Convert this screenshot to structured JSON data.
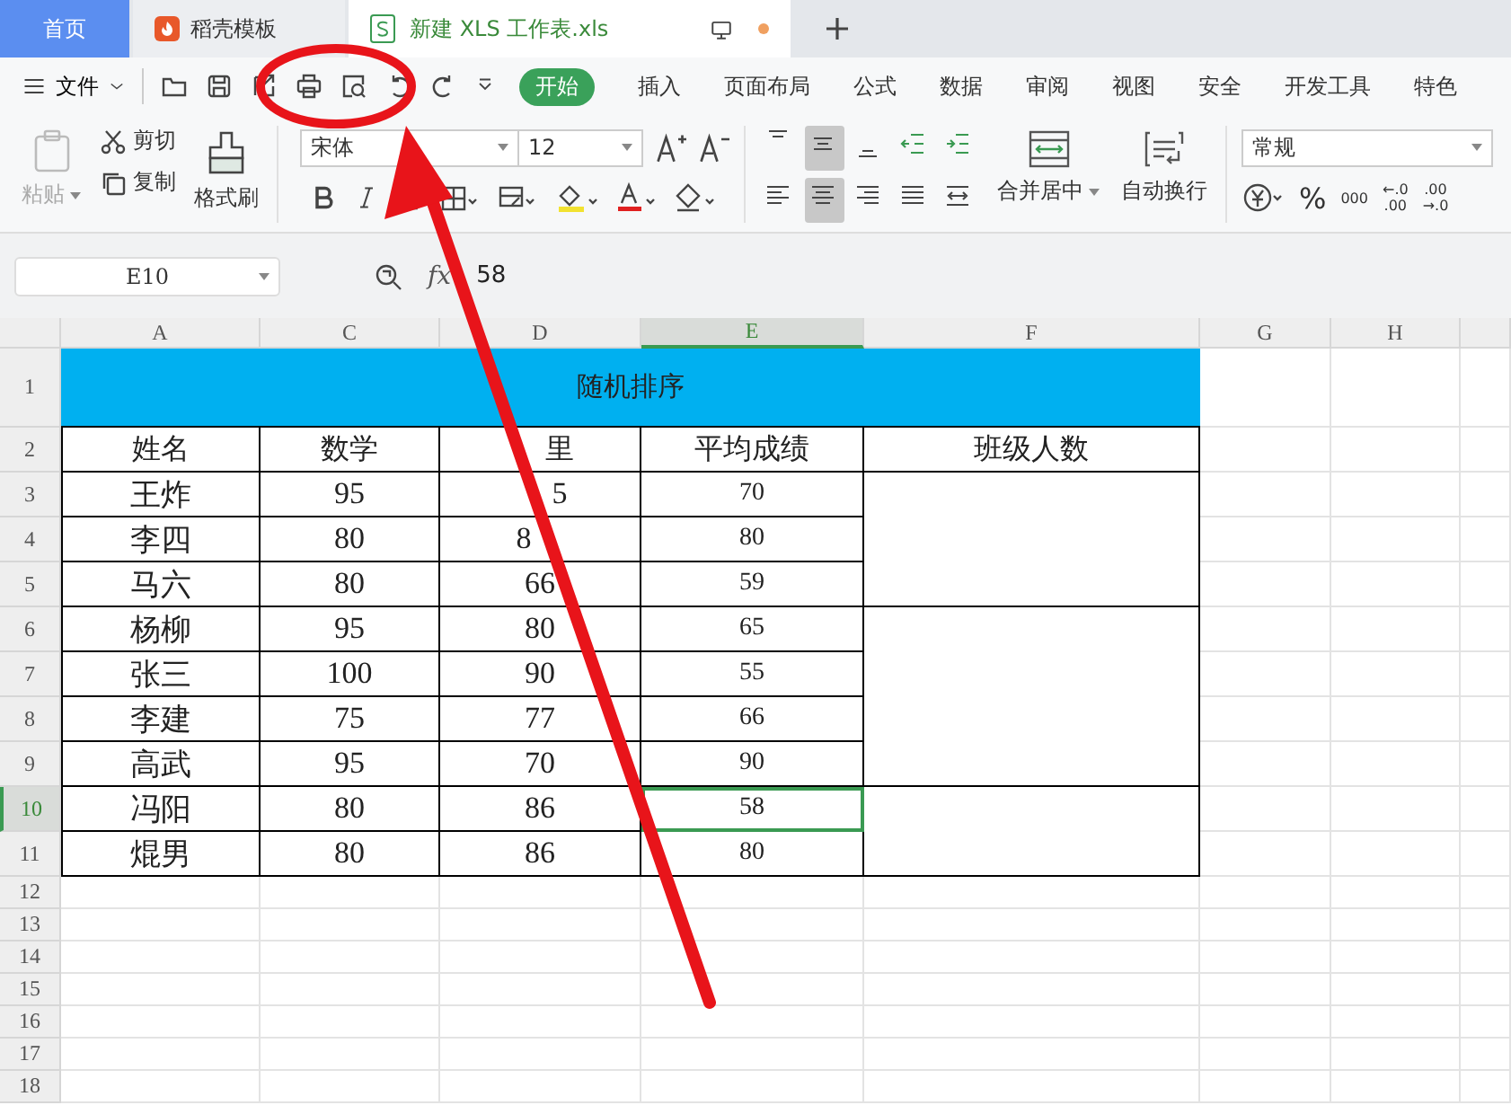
{
  "tabs": [
    {
      "kind": "home",
      "label": "首页",
      "selected": false
    },
    {
      "kind": "docer",
      "label": "稻壳模板",
      "selected": false
    },
    {
      "kind": "file",
      "label": "新建 XLS 工作表.xls",
      "selected": true
    }
  ],
  "menu": {
    "file": "文件",
    "ribbon_tabs": [
      {
        "label": "开始",
        "selected": true
      },
      {
        "label": "插入",
        "selected": false
      },
      {
        "label": "页面布局",
        "selected": false
      },
      {
        "label": "公式",
        "selected": false
      },
      {
        "label": "数据",
        "selected": false
      },
      {
        "label": "审阅",
        "selected": false
      },
      {
        "label": "视图",
        "selected": false
      },
      {
        "label": "安全",
        "selected": false
      },
      {
        "label": "开发工具",
        "selected": false
      },
      {
        "label": "特色",
        "selected": false
      }
    ]
  },
  "ribbon": {
    "paste": {
      "label": "粘贴",
      "disabled": true
    },
    "cut": "剪切",
    "copy": "复制",
    "format_painter": "格式刷",
    "font_name": "宋体",
    "font_size": "12",
    "align_buttons": [
      {
        "kind": "top",
        "selected": false
      },
      {
        "kind": "middle",
        "selected": true
      },
      {
        "kind": "bottom",
        "selected": false
      },
      {
        "kind": "outdent",
        "selected": false
      },
      {
        "kind": "indent",
        "selected": false
      },
      {
        "kind": "left",
        "selected": false
      },
      {
        "kind": "center",
        "selected": true
      },
      {
        "kind": "right",
        "selected": false
      },
      {
        "kind": "justify",
        "selected": false
      },
      {
        "kind": "distributed",
        "selected": false
      }
    ],
    "merge": "合并居中",
    "wrap": "自动换行",
    "number_format": "常规",
    "percent": "%",
    "thousands": "000",
    "decimal_buttons": [
      {
        "top": "←.0",
        "bottom": ".00"
      },
      {
        "top": ".00",
        "bottom": "→.0"
      }
    ]
  },
  "formula_bar": {
    "cell": "E10",
    "fx": "fx",
    "value": "58"
  },
  "sheet": {
    "columns": [
      {
        "label": "A",
        "selected": false
      },
      {
        "label": "C",
        "selected": false
      },
      {
        "label": "D",
        "selected": false
      },
      {
        "label": "E",
        "selected": true
      },
      {
        "label": "F",
        "selected": false
      },
      {
        "label": "G",
        "selected": false
      },
      {
        "label": "H",
        "selected": false
      }
    ],
    "row_numbers": [
      {
        "label": "1",
        "selected": false
      },
      {
        "label": "2",
        "selected": false
      },
      {
        "label": "3",
        "selected": false
      },
      {
        "label": "4",
        "selected": false
      },
      {
        "label": "5",
        "selected": false
      },
      {
        "label": "6",
        "selected": false
      },
      {
        "label": "7",
        "selected": false
      },
      {
        "label": "8",
        "selected": false
      },
      {
        "label": "9",
        "selected": false
      },
      {
        "label": "10",
        "selected": true
      },
      {
        "label": "11",
        "selected": false
      },
      {
        "label": "12",
        "selected": false
      },
      {
        "label": "13",
        "selected": false
      },
      {
        "label": "14",
        "selected": false
      },
      {
        "label": "15",
        "selected": false
      },
      {
        "label": "16",
        "selected": false
      },
      {
        "label": "17",
        "selected": false
      },
      {
        "label": "18",
        "selected": false
      }
    ],
    "title": "随机排序",
    "headers": [
      {
        "text": "姓名",
        "kind": "whole"
      },
      {
        "text": "数学",
        "kind": "whole"
      },
      {
        "text": "里",
        "kind": "tail"
      },
      {
        "text": "平均成绩",
        "kind": "whole"
      },
      {
        "text": "班级人数",
        "kind": "whole"
      }
    ],
    "groups": [
      {
        "rows": [
          {
            "cells": [
              {
                "text": "王炸",
                "kind": "whole"
              },
              {
                "text": "95",
                "kind": "whole"
              },
              {
                "text": "5",
                "kind": "tail"
              },
              {
                "text": "70",
                "kind": "whole"
              }
            ]
          },
          {
            "cells": [
              {
                "text": "李四",
                "kind": "whole"
              },
              {
                "text": "80",
                "kind": "whole"
              },
              {
                "text": "8",
                "kind": "head"
              },
              {
                "text": "80",
                "kind": "whole"
              }
            ]
          },
          {
            "cells": [
              {
                "text": "马六",
                "kind": "whole"
              },
              {
                "text": "80",
                "kind": "whole"
              },
              {
                "text": "66",
                "kind": "whole"
              },
              {
                "text": "59",
                "kind": "whole"
              }
            ]
          }
        ]
      },
      {
        "rows": [
          {
            "cells": [
              {
                "text": "杨柳",
                "kind": "whole"
              },
              {
                "text": "95",
                "kind": "whole"
              },
              {
                "text": "80",
                "kind": "whole"
              },
              {
                "text": "65",
                "kind": "whole"
              }
            ]
          },
          {
            "cells": [
              {
                "text": "张三",
                "kind": "whole"
              },
              {
                "text": "100",
                "kind": "whole"
              },
              {
                "text": "90",
                "kind": "whole"
              },
              {
                "text": "55",
                "kind": "whole"
              }
            ]
          },
          {
            "cells": [
              {
                "text": "李建",
                "kind": "whole"
              },
              {
                "text": "75",
                "kind": "whole"
              },
              {
                "text": "77",
                "kind": "whole"
              },
              {
                "text": "66",
                "kind": "whole"
              }
            ]
          },
          {
            "cells": [
              {
                "text": "高武",
                "kind": "whole"
              },
              {
                "text": "95",
                "kind": "whole"
              },
              {
                "text": "70",
                "kind": "whole"
              },
              {
                "text": "90",
                "kind": "whole"
              }
            ]
          }
        ]
      },
      {
        "rows": [
          {
            "cells": [
              {
                "text": "冯阳",
                "kind": "whole"
              },
              {
                "text": "80",
                "kind": "whole"
              },
              {
                "text": "86",
                "kind": "whole"
              },
              {
                "text": "58",
                "kind": "whole"
              }
            ]
          },
          {
            "cells": [
              {
                "text": "焜男",
                "kind": "whole"
              },
              {
                "text": "80",
                "kind": "whole"
              },
              {
                "text": "86",
                "kind": "whole"
              },
              {
                "text": "80",
                "kind": "whole"
              }
            ]
          }
        ]
      }
    ]
  }
}
